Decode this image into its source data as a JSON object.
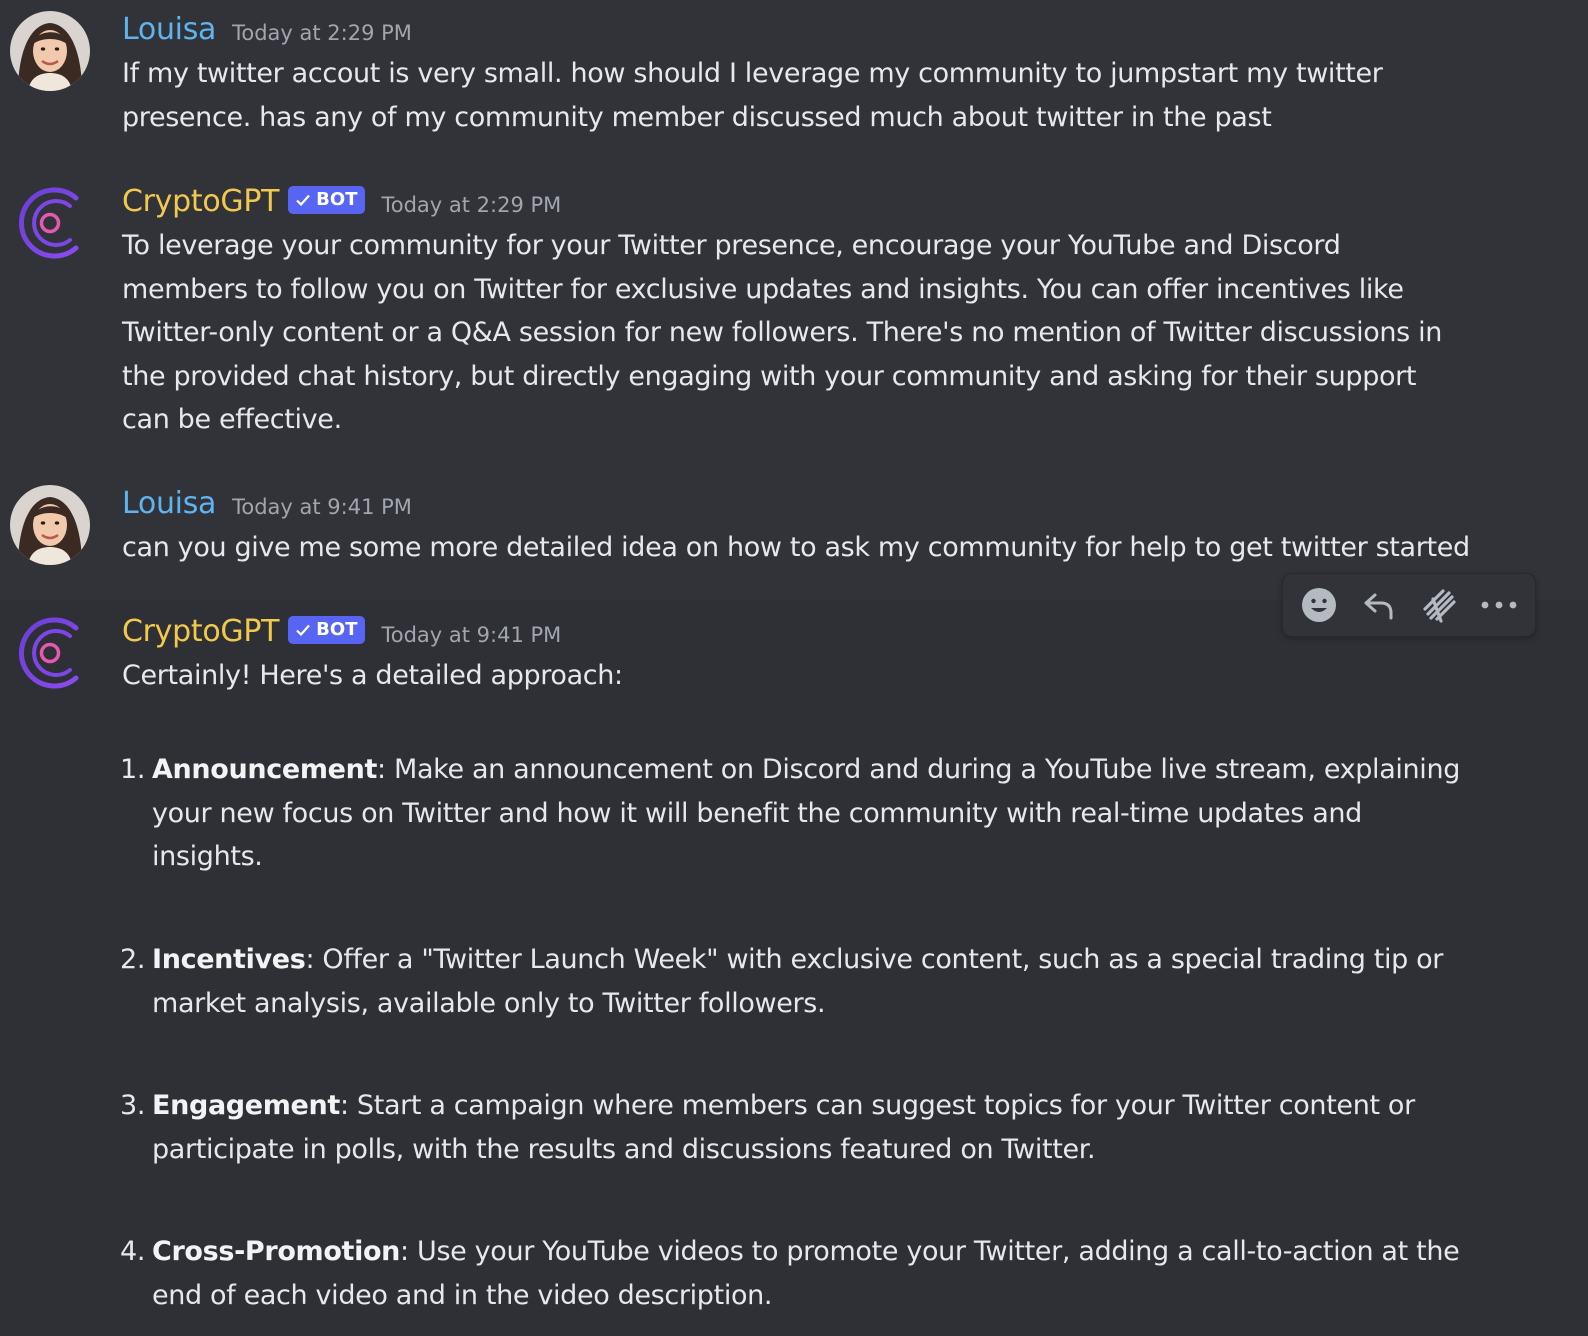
{
  "messages": [
    {
      "username": "Louisa",
      "timestamp": "Today at 2:29 PM",
      "text": "If my twitter accout is very small. how should I leverage my community to jumpstart my twitter\npresence. has any of my community member discussed much about twitter in the past"
    },
    {
      "username": "CryptoGPT",
      "badge": "BOT",
      "timestamp": "Today at 2:29 PM",
      "text": "To leverage your community for your Twitter presence, encourage your YouTube and Discord\nmembers to follow you on Twitter for exclusive updates and insights. You can offer incentives like\nTwitter-only content or a Q&A session for new followers. There's no mention of Twitter discussions in\nthe provided chat history, but directly engaging with your community and asking for their support\ncan be effective."
    },
    {
      "username": "Louisa",
      "timestamp": "Today at 9:41 PM",
      "text": "can you give me some more detailed idea on how to ask my community for help to get twitter started"
    },
    {
      "username": "CryptoGPT",
      "badge": "BOT",
      "timestamp": "Today at 9:41 PM",
      "intro": "Certainly! Here's a detailed approach:",
      "items": [
        {
          "number": "1.",
          "title": "Announcement",
          "text": ": Make an announcement on Discord and during a YouTube live stream, explaining your new focus on Twitter and how it will benefit the community with real-time updates and insights."
        },
        {
          "number": "2.",
          "title": "Incentives",
          "text": ": Offer a \"Twitter Launch Week\" with exclusive content, such as a special trading tip or market analysis, available only to Twitter followers."
        },
        {
          "number": "3.",
          "title": "Engagement",
          "text": ": Start a campaign where members can suggest topics for your Twitter content or participate in polls, with the results and discussions featured on Twitter."
        },
        {
          "number": "4.",
          "title": "Cross-Promotion",
          "text": ": Use your YouTube videos to promote your Twitter, adding a call-to-action at the end of each video and in the video description."
        }
      ]
    }
  ],
  "toolbar": {
    "buttons": [
      "emoji-reaction-icon",
      "reply-icon",
      "thread-icon",
      "more-options-icon"
    ]
  },
  "colors": {
    "background": "#313338",
    "user_name": "#5fb3ee",
    "bot_name": "#f2c94c",
    "bot_badge": "#5865f2",
    "text": "#e6e8eb",
    "timestamp": "#a1a5ad"
  }
}
